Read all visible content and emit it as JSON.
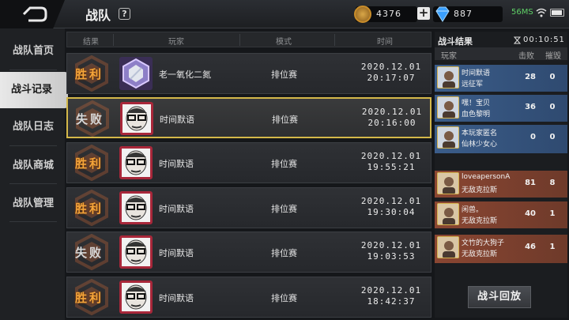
{
  "header": {
    "title": "战队",
    "help": "?",
    "coins": "4376",
    "plus": "+",
    "gems": "887",
    "ping": "56MS"
  },
  "sidebar": {
    "items": [
      {
        "label": "战队首页"
      },
      {
        "label": "战斗记录"
      },
      {
        "label": "战队日志"
      },
      {
        "label": "战队商城"
      },
      {
        "label": "战队管理"
      }
    ]
  },
  "table": {
    "headers": [
      "结果",
      "玩家",
      "模式",
      "时间"
    ],
    "rows": [
      {
        "result": "胜利",
        "player": "老一氧化二氮",
        "mode": "排位赛",
        "date": "2020.12.01",
        "time": "20:17:07",
        "avatar": "crystal-badge"
      },
      {
        "result": "失败",
        "player": "时间默语",
        "mode": "排位赛",
        "date": "2020.12.01",
        "time": "20:16:00",
        "avatar": "face-with-glasses"
      },
      {
        "result": "胜利",
        "player": "时间默语",
        "mode": "排位赛",
        "date": "2020.12.01",
        "time": "19:55:21",
        "avatar": "face-with-glasses"
      },
      {
        "result": "胜利",
        "player": "时间默语",
        "mode": "排位赛",
        "date": "2020.12.01",
        "time": "19:30:04",
        "avatar": "face-with-glasses"
      },
      {
        "result": "失败",
        "player": "时间默语",
        "mode": "排位赛",
        "date": "2020.12.01",
        "time": "19:03:53",
        "avatar": "face-with-glasses"
      },
      {
        "result": "胜利",
        "player": "时间默语",
        "mode": "排位赛",
        "date": "2020.12.01",
        "time": "18:42:37",
        "avatar": "face-with-glasses"
      }
    ]
  },
  "result_panel": {
    "title": "战斗结果",
    "timer": "00:10:51",
    "col_player": "玩家",
    "col_kills": "击败",
    "col_downs": "摧毁",
    "players": [
      {
        "name": "时间默语",
        "team": "远征军",
        "kills": "28",
        "downs": "0",
        "side": "blue"
      },
      {
        "name": "嘿！宝贝",
        "team": "血色黎明",
        "kills": "36",
        "downs": "0",
        "side": "blue"
      },
      {
        "name": "本玩家匿名",
        "team": "仙林少女心",
        "kills": "0",
        "downs": "0",
        "side": "blue"
      },
      {
        "name": "loveapersonA",
        "team": "无敌克拉斯",
        "kills": "81",
        "downs": "8",
        "side": "red"
      },
      {
        "name": "闲兽。",
        "team": "无敌克拉斯",
        "kills": "40",
        "downs": "1",
        "side": "red"
      },
      {
        "name": "文竹的大狗子",
        "team": "无敌克拉斯",
        "kills": "46",
        "downs": "1",
        "side": "red"
      }
    ],
    "replay_label": "战斗回放"
  },
  "colors": {
    "win": "#f5a53a",
    "lose": "#d8d8d8",
    "accent": "#d4b84a"
  }
}
